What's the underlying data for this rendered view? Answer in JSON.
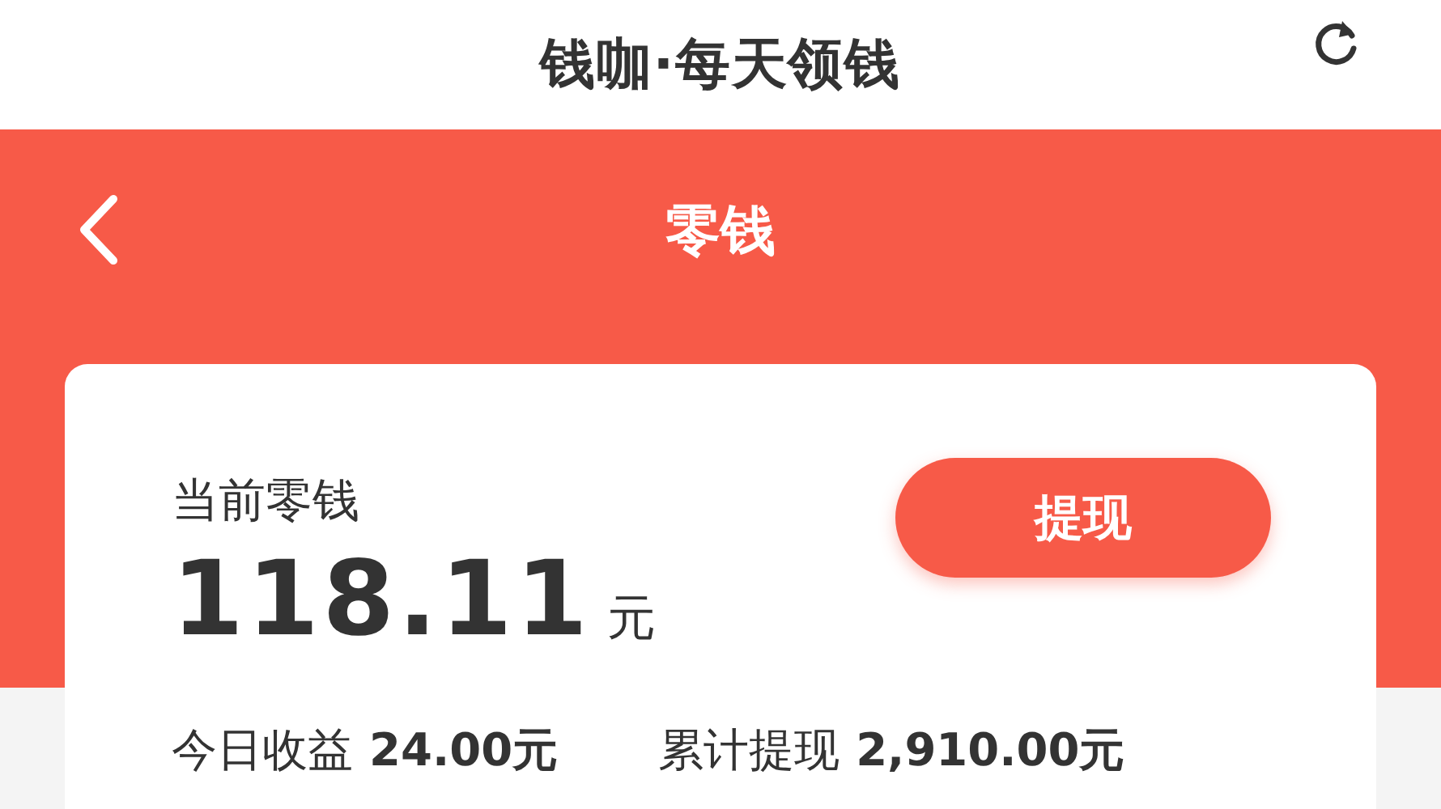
{
  "app_bar": {
    "title": "钱咖·每天领钱"
  },
  "header": {
    "title": "零钱"
  },
  "balance": {
    "label": "当前零钱",
    "amount": "118.11",
    "unit": "元",
    "button": "提现"
  },
  "stats": [
    {
      "label": "今日收益",
      "value": "24.00元"
    },
    {
      "label": "累计提现",
      "value": "2,910.00元"
    }
  ]
}
